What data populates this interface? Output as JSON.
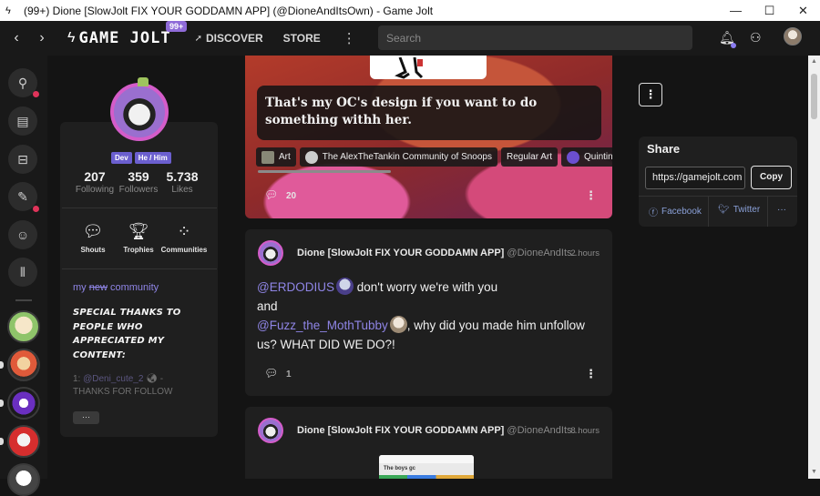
{
  "window": {
    "title": "(99+) Dione [SlowJolt FIX YOUR GODDAMN APP] (@DioneAndItsOwn) - Game Jolt",
    "minimize": "—",
    "maximize": "☐",
    "close": "✕"
  },
  "topnav": {
    "logo": "GAME JOLT",
    "badge": "99+",
    "discover": "DISCOVER",
    "store": "STORE",
    "search_placeholder": "Search"
  },
  "profile": {
    "tags": [
      "Dev",
      "He / Him"
    ],
    "stats": [
      {
        "value": "207",
        "label": "Following"
      },
      {
        "value": "359",
        "label": "Followers"
      },
      {
        "value": "5.738",
        "label": "Likes"
      }
    ],
    "nav": [
      {
        "label": "Shouts",
        "icon": "speech-bubble-icon"
      },
      {
        "label": "Trophies",
        "icon": "trophy-icon"
      },
      {
        "label": "Communities",
        "icon": "communities-icon"
      }
    ],
    "bio_link_prefix": "my ",
    "bio_link_strike": "new",
    "bio_link_suffix": " community",
    "bio_special": "SPECIAL THANKS TO PEOPLE WHO APPRECIATED MY CONTENT:",
    "bio_fade_1": "1: ",
    "bio_fade_mention": "@Deni_cute_2",
    "bio_fade_2": " -",
    "bio_fade_3": "THANKS FOR FOLLOW",
    "more": "···"
  },
  "post1": {
    "caption": "That's my OC's design if you want to do something withh her.",
    "chips": [
      "Art",
      "The AlexTheTankin Community of Snoops",
      "Regular Art",
      "Quintin"
    ],
    "comments": "20"
  },
  "post2": {
    "author": "Dione [SlowJolt FIX YOUR GODDAMN APP]",
    "handle": "@DioneAndIts...",
    "time": "2 hours",
    "mention1": "@ERDODIUS",
    "text1": " don't worry we're with you",
    "text2": "and",
    "mention2": "@Fuzz_the_MothTubby",
    "text3": ", why did you made him unfollow us? WHAT DID WE DO?!",
    "comments": "1"
  },
  "post3": {
    "author": "Dione [SlowJolt FIX YOUR GODDAMN APP]",
    "handle": "@DioneAndIts...",
    "time": "8 hours",
    "screenshot_chat": "The boys gc"
  },
  "share": {
    "title": "Share",
    "url": "https://gamejolt.com",
    "copy": "Copy",
    "facebook": "Facebook",
    "twitter": "Twitter",
    "more": "···"
  }
}
